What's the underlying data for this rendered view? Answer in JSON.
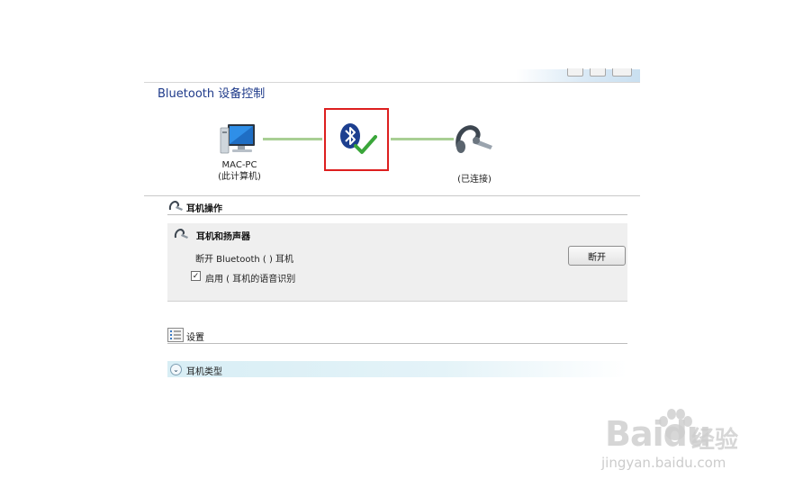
{
  "window": {
    "title": "Bluetooth 设备控制"
  },
  "diagram": {
    "computer_name": "MAC-PC",
    "computer_sub": "(此计算机)",
    "device_status": "(已连接)"
  },
  "headset_ops": {
    "section_title": "耳机操作",
    "panel_title": "耳机和扬声器",
    "disconnect_text": "断开 Bluetooth (    ) 耳机",
    "disconnect_button": "断开",
    "voice_checkbox_label": "启用 (        耳机的语音识别",
    "voice_checked": true
  },
  "settings": {
    "section_title": "设置"
  },
  "headset_type": {
    "label": "耳机类型"
  },
  "watermark": {
    "brand": "Baidu",
    "brand_cn": "经验",
    "url": "jingyan.baidu.com"
  },
  "colors": {
    "highlight_box": "#dd1f1f",
    "link_line": "#a9cf94",
    "title": "#1e3a8a"
  },
  "icons": [
    "computer-icon",
    "bluetooth-icon",
    "checkmark-icon",
    "headset-icon",
    "expand-chevron-icon",
    "settings-list-icon"
  ]
}
